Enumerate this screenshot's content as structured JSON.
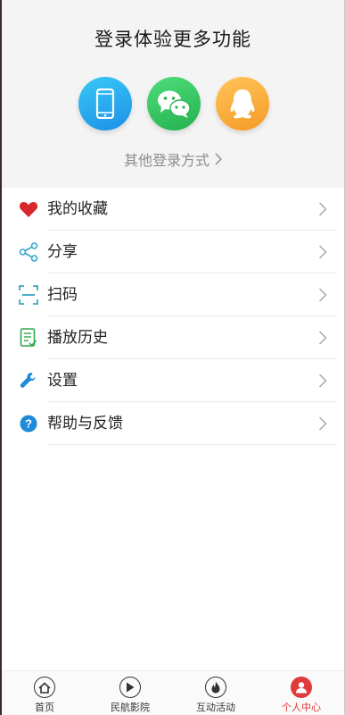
{
  "login": {
    "title": "登录体验更多功能",
    "options": [
      {
        "name": "phone-login",
        "icon": "phone-icon",
        "color": "#1d8fe8"
      },
      {
        "name": "wechat-login",
        "icon": "wechat-icon",
        "color": "#24b24f"
      },
      {
        "name": "qq-login",
        "icon": "qq-icon",
        "color": "#f59a26"
      }
    ],
    "other_label": "其他登录方式"
  },
  "menu": {
    "items": [
      {
        "label": "我的收藏",
        "icon": "heart-icon",
        "color": "#d9272e"
      },
      {
        "label": "分享",
        "icon": "share-icon",
        "color": "#3aa6c9"
      },
      {
        "label": "扫码",
        "icon": "scan-icon",
        "color": "#3aa6c9"
      },
      {
        "label": "播放历史",
        "icon": "history-icon",
        "color": "#2fa84f"
      },
      {
        "label": "设置",
        "icon": "settings-icon",
        "color": "#1e8bd8"
      },
      {
        "label": "帮助与反馈",
        "icon": "help-icon",
        "color": "#1e8bd8"
      }
    ]
  },
  "tabbar": {
    "tabs": [
      {
        "label": "首页",
        "icon": "home-icon",
        "active": false
      },
      {
        "label": "民航影院",
        "icon": "play-icon",
        "active": false
      },
      {
        "label": "互动活动",
        "icon": "fire-icon",
        "active": false
      },
      {
        "label": "个人中心",
        "icon": "person-icon",
        "active": true
      }
    ],
    "active_color": "#e03a3a"
  }
}
